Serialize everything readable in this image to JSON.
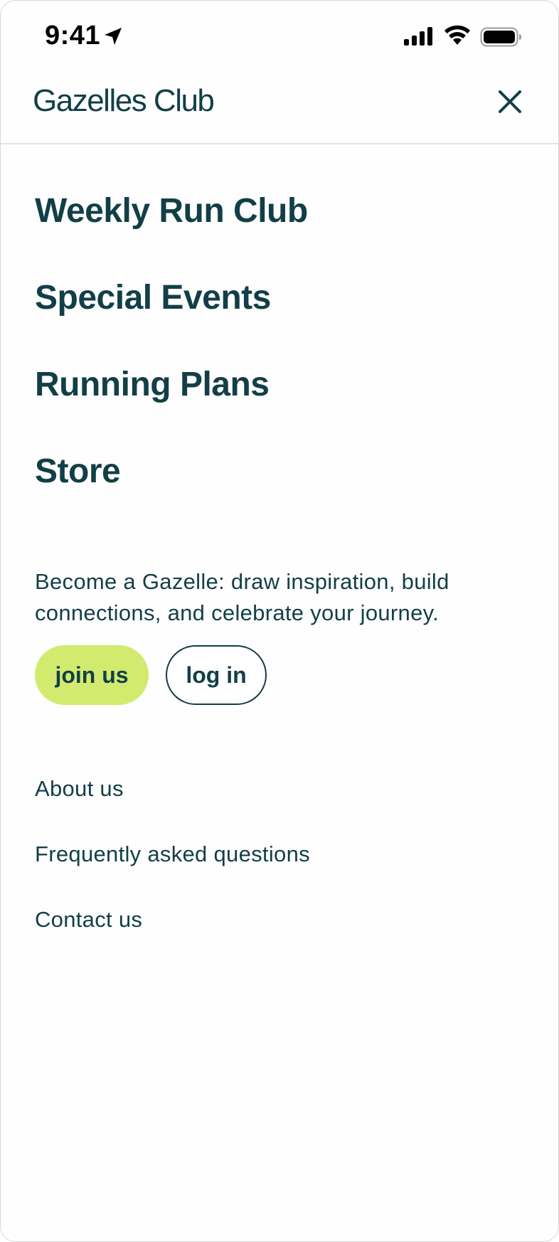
{
  "status_bar": {
    "time": "9:41",
    "icons": [
      "location-arrow-icon",
      "cellular-signal-icon",
      "wifi-icon",
      "battery-icon"
    ]
  },
  "header": {
    "brand": "Gazelles Club",
    "close_icon": "close-icon"
  },
  "primary_nav": {
    "items": [
      {
        "label": "Weekly Run Club"
      },
      {
        "label": "Special Events"
      },
      {
        "label": "Running Plans"
      },
      {
        "label": "Store"
      }
    ]
  },
  "promo": {
    "text": "Become a Gazelle: draw inspiration, build connections, and celebrate your journey.",
    "join_label": "join us",
    "login_label": "log in"
  },
  "secondary_nav": {
    "items": [
      {
        "label": "About us"
      },
      {
        "label": "Frequently asked questions"
      },
      {
        "label": "Contact us"
      }
    ]
  },
  "colors": {
    "brand_text": "#123f47",
    "accent": "#d2eb6e",
    "divider": "#e4e4e4"
  }
}
